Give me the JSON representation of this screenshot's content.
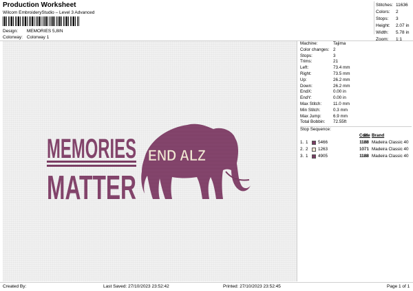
{
  "header": {
    "title": "Production Worksheet",
    "software": "Wilcom EmbroideryStudio – Level 3 Advanced"
  },
  "meta": {
    "design_label": "Design:",
    "design_value": "MEMORIES 5,8IN",
    "colorway_label": "Colorway:",
    "colorway_value": "Colorway 1"
  },
  "stats": [
    {
      "label": "Stitches:",
      "value": "11636"
    },
    {
      "label": "Colors:",
      "value": "2"
    },
    {
      "label": "Stops:",
      "value": "3"
    },
    {
      "label": "Height:",
      "value": "2.07 in"
    },
    {
      "label": "Width:",
      "value": "5.78 in"
    },
    {
      "label": "Zoom:",
      "value": "1:1"
    }
  ],
  "info": [
    {
      "label": "Machine:",
      "value": "Tajima"
    },
    {
      "label": "Color changes:",
      "value": "2"
    },
    {
      "label": "Stops:",
      "value": "3"
    },
    {
      "label": "Trims:",
      "value": "21"
    },
    {
      "label": "Left:",
      "value": "73.4 mm"
    },
    {
      "label": "Right:",
      "value": "73.5 mm"
    },
    {
      "label": "Up:",
      "value": "26.2 mm"
    },
    {
      "label": "Down:",
      "value": "26.2 mm"
    },
    {
      "label": "EndX:",
      "value": "0.00 in"
    },
    {
      "label": "EndY:",
      "value": "0.00 in"
    },
    {
      "label": "Max Stitch:",
      "value": "11.0 mm"
    },
    {
      "label": "Min Stitch:",
      "value": "0.3 mm"
    },
    {
      "label": "Max Jump:",
      "value": "6.9 mm"
    },
    {
      "label": "Total Bobbin:",
      "value": "72.55ft"
    }
  ],
  "stop_sequence": {
    "title": "Stop Sequence:",
    "columns": {
      "st": "St.",
      "code": "Code",
      "brand": "Brand"
    },
    "rows": [
      {
        "idx": "1.",
        "stop": "1",
        "color": "#7a3d63",
        "number": "5466",
        "stitches": "1188",
        "code": "1188",
        "brand": "Madeira Classic 40"
      },
      {
        "idx": "2.",
        "stop": "2",
        "color": "#f0e6d2",
        "number": "1263",
        "stitches": "1071",
        "code": "1071",
        "brand": "Madeira Classic 40"
      },
      {
        "idx": "3.",
        "stop": "1",
        "color": "#7a3d63",
        "number": "4905",
        "stitches": "1188",
        "code": "1188",
        "brand": "Madeira Classic 40"
      }
    ]
  },
  "design": {
    "line1": "MEMORIES",
    "line2": "MATTER",
    "overlay": "END ALZ",
    "thread_color": "#7a3d63",
    "overlay_color": "#f0e6d2"
  },
  "footer": {
    "created_by": "Created By:",
    "last_saved": "Last Saved: 27/10/2023 23:52:42",
    "printed": "Printed: 27/10/2023 23:52:45",
    "page": "Page 1 of 1"
  }
}
